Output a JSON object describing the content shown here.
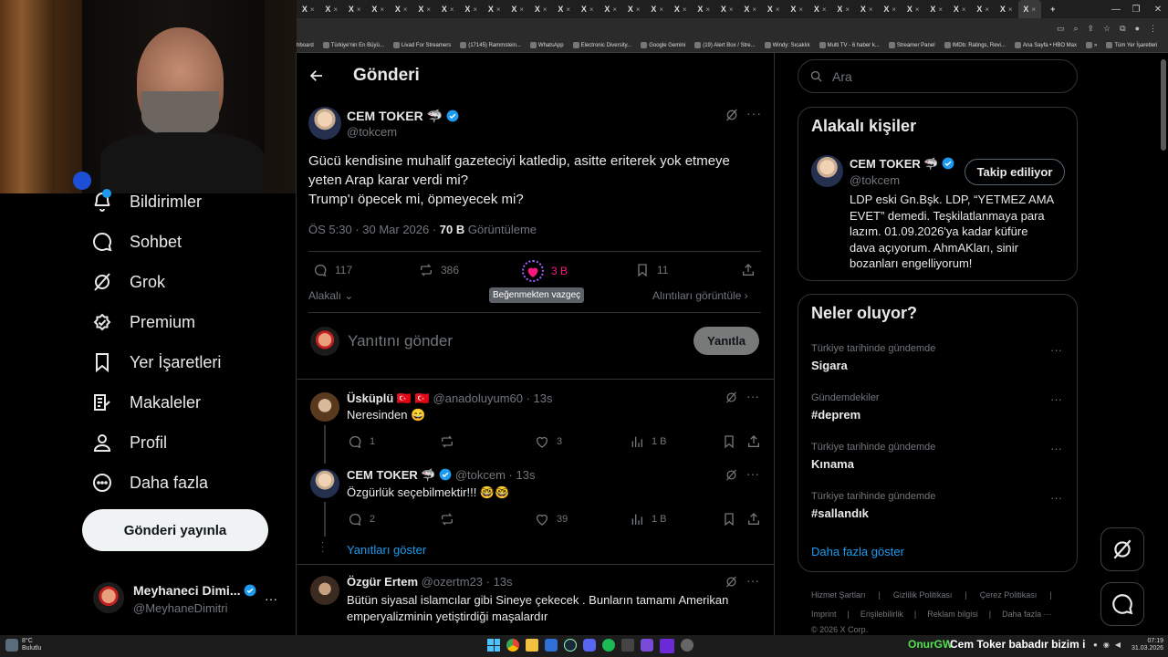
{
  "browser": {
    "tab_label": "X",
    "tab_count": 32,
    "bookmarks": [
      "hboard",
      "Türkiye'nin En Büyü...",
      "Livad For Streamers",
      "(17145) Rammstein...",
      "WhatsApp",
      "Electronic Diversity...",
      "Google Gemini",
      "(19) Alert Box / Stre...",
      "Windy: Sıcaklık",
      "Multi TV - 6 haber k...",
      "Streamer Panel",
      "IMDb: Ratings, Revi...",
      "Ana Sayfa • HBO Max",
      "»",
      "Tüm Yer İşaretleri"
    ]
  },
  "nav": {
    "notifications": "Bildirimler",
    "messages": "Sohbet",
    "grok": "Grok",
    "premium": "Premium",
    "bookmarks": "Yer İşaretleri",
    "articles": "Makaleler",
    "profile": "Profil",
    "more": "Daha fazla",
    "post_button": "Gönderi yayınla",
    "account_name": "Meyhaneci Dimi...",
    "account_handle": "@MeyhaneDimitri",
    "account_more": "···"
  },
  "header": {
    "title": "Gönderi"
  },
  "post": {
    "author": "CEM TOKER",
    "emoji": "🦈",
    "handle": "@tokcem",
    "line1": "Gücü kendisine muhalif gazeteciyi katledip, asitte eriterek yok etmeye",
    "line2": "yeten Arap karar verdi mi?",
    "line3": "Trump'ı öpecek mi, öpmeyecek mi?",
    "meta": "ÖS 5:30 · 30 Mar 2026 · ",
    "views": "70 B",
    "views_label": " Görüntüleme",
    "replies": "117",
    "reposts": "386",
    "likes": "3 B",
    "bookmarks_count": "11",
    "tooltip": "Beğenmekten vazgeç",
    "sort": "Alakalı",
    "quotes": "Alıntıları görüntüle"
  },
  "compose": {
    "placeholder": "Yanıtını gönder",
    "button": "Yanıtla"
  },
  "replies": [
    {
      "name": "Üsküplü 🇹🇷 🇹🇷",
      "handle": "@anadoluyum60 · 13s",
      "text": "Neresinden 😄",
      "replies": "1",
      "likes": "3",
      "views": "1 B"
    },
    {
      "name": "CEM TOKER",
      "emoji": "🦈",
      "handle": "@tokcem · 13s",
      "text": "Özgürlük seçebilmektir!!! 🤓🤓",
      "replies": "2",
      "likes": "39",
      "views": "1 B"
    },
    {
      "name": "Özgür Ertem",
      "handle": "@ozertm23 · 13s",
      "text1": "Bütün siyasal islamcılar gibi Sineye çekecek . Bunların tamamı Amerikan",
      "text2": "emperyalizminin yetiştirdiği maşalardır"
    }
  ],
  "show_replies": "Yanıtları göster",
  "search": {
    "placeholder": "Ara"
  },
  "related": {
    "title": "Alakalı kişiler",
    "name": "CEM TOKER",
    "emoji": "🦈",
    "handle": "@tokcem",
    "follow_button": "Takip ediliyor",
    "bio": [
      "LDP eski Gn.Bşk. LDP, “YETMEZ AMA",
      "EVET” demedi. Teşkilatlanmaya para",
      "lazım. 01.09.2026'ya kadar küfüre",
      "dava açıyorum. AhmAKları, sinir",
      "bozanları engelliyorum!"
    ]
  },
  "trends": {
    "title": "Neler oluyor?",
    "items": [
      {
        "context": "Türkiye tarihinde gündemde",
        "name": "Sigara"
      },
      {
        "context": "Gündemdekiler",
        "name": "#deprem"
      },
      {
        "context": "Türkiye tarihinde gündemde",
        "name": "Kınama"
      },
      {
        "context": "Türkiye tarihinde gündemde",
        "name": "#sallandık"
      }
    ],
    "more_link": "Daha fazla göster"
  },
  "footer": {
    "row1": [
      "Hizmet Şartları",
      "Gizlilik Politikası",
      "Çerez Politikası"
    ],
    "row2": [
      "Imprint",
      "Erişilebilirlik",
      "Reklam bilgisi",
      "Daha fazla ···"
    ],
    "copyright": "© 2026 X Corp."
  },
  "taskbar": {
    "weather_temp": "8°C",
    "weather_desc": "Bulutlu",
    "ticker_name": "OnurGW",
    "ticker_text": "Cem Toker babadır bizim için",
    "time": "07:19",
    "date": "31.03.2026"
  },
  "colors": {
    "accent": "#1d9bf0",
    "like": "#f91880",
    "bg": "#000000",
    "border": "#2f3336",
    "muted": "#71767b"
  }
}
